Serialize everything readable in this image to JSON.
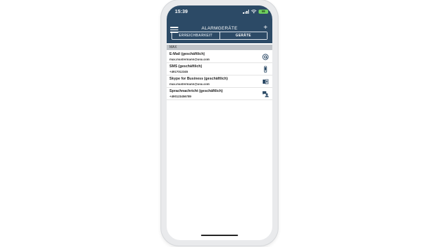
{
  "status_bar": {
    "time": "15:39",
    "battery": "99"
  },
  "nav": {
    "title": "ALARMGERÄTE",
    "add_label": "+"
  },
  "tabs": [
    {
      "label": "ERREICHBARKEIT",
      "active": false
    },
    {
      "label": "GERÄTE",
      "active": true
    }
  ],
  "section": {
    "label": "MAX"
  },
  "devices": [
    {
      "title": "E-Mail (geschäftlich)",
      "subtitle": "max.mustermann@usu.com",
      "icon": "email-at-icon"
    },
    {
      "title": "SMS (geschäftlich)",
      "subtitle": "+4917012345",
      "icon": "mobile-phone-icon"
    },
    {
      "title": "Skype for Business (geschäftlich)",
      "subtitle": "max.mustermann@usu.com",
      "icon": "skype-book-icon"
    },
    {
      "title": "Sprachnachricht (geschäftlich)",
      "subtitle": "+490123456789",
      "icon": "voice-message-icon"
    }
  ],
  "colors": {
    "header": "#2c4a66",
    "icon": "#2c4a66",
    "section": "#bfc3c8",
    "battery": "#6fcf5e"
  }
}
